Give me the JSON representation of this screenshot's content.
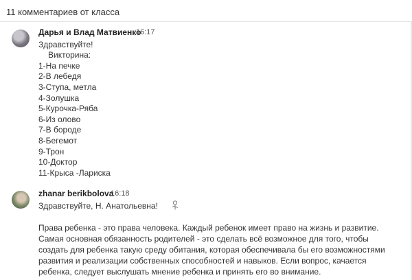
{
  "header": {
    "count_label": "11 комментариев от класса"
  },
  "comments": [
    {
      "author": "Дарья и Влад Матвиенко",
      "time": "16:17",
      "lines": [
        "Здравствуйте!",
        "Викторина:",
        "1-На печке",
        "2-В лебедя",
        "3-Ступа, метла",
        "4-Золушка",
        "5-Курочка-Ряба",
        "6-Из олово",
        "7-В бороде",
        "8-Бегемот",
        "9-Трон",
        "10-Доктор",
        "11-Крыса -Лариска"
      ]
    },
    {
      "author": "zhanar berikbolova",
      "time": "16:18",
      "greeting": "Здравствуйте, Н. Анатольевна!",
      "body": "Права ребенка - это права человека. Каждый ребенок имеет право на жизнь и развитие. Самая основная обязанность родителей - это сделать всё возможное для того, чтобы создать для ребенка такую среду обитания, которая обеспечивала бы его возможностями развития и реализации собственных способностей и навыков. Если вопрос, качается ребенка, следует выслушать мнение ребенка и принять его во внимание."
    }
  ]
}
